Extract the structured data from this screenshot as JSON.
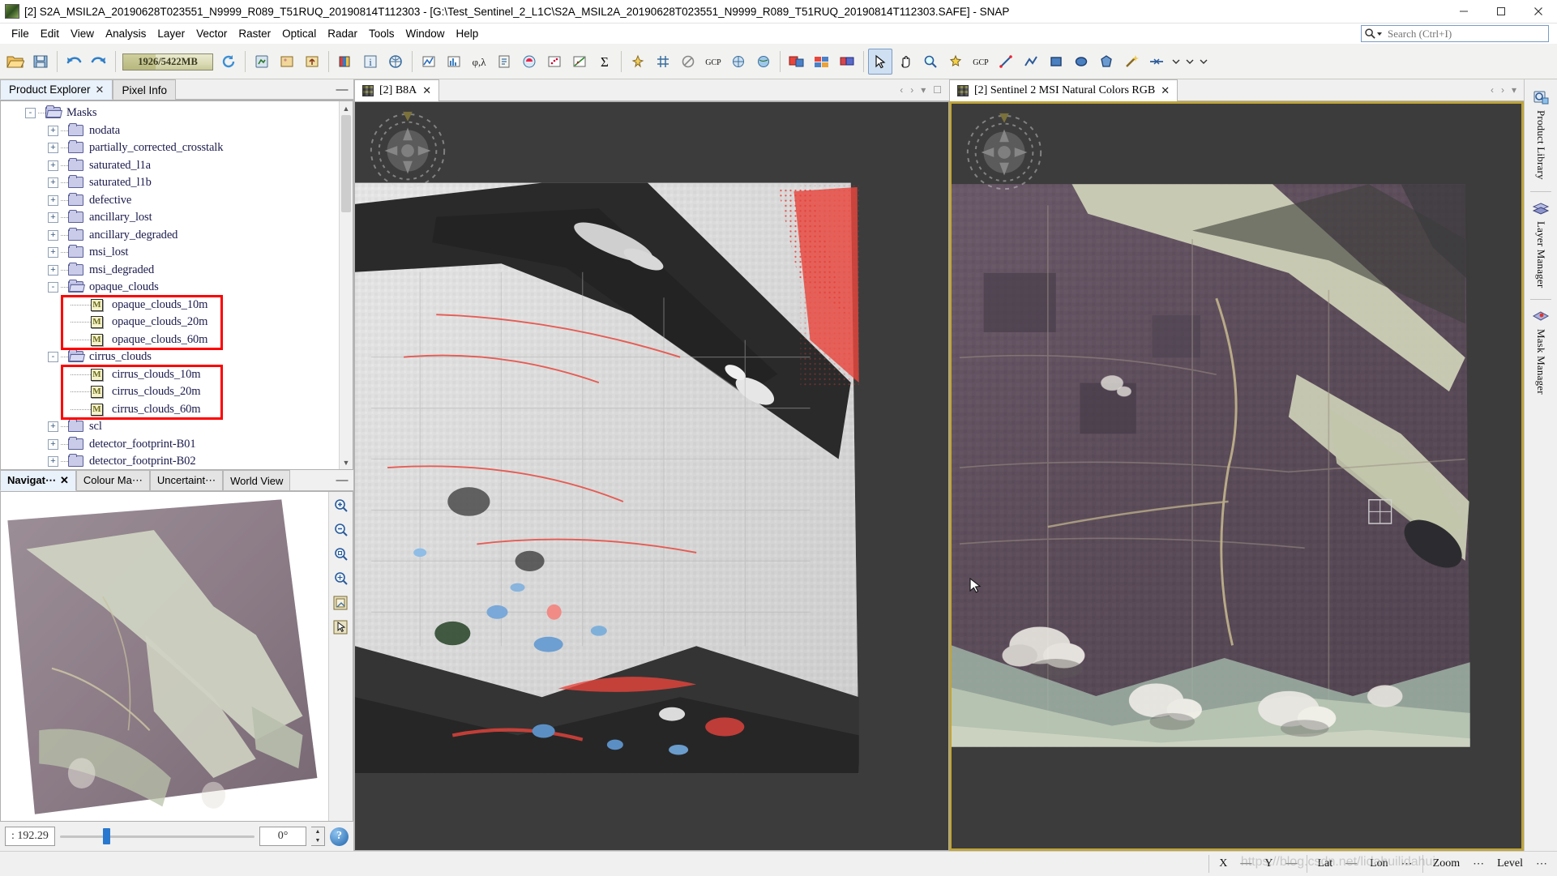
{
  "window": {
    "title": "[2] S2A_MSIL2A_20190628T023551_N9999_R089_T51RUQ_20190814T112303 - [G:\\Test_Sentinel_2_L1C\\S2A_MSIL2A_20190628T023551_N9999_R089_T51RUQ_20190814T112303.SAFE] - SNAP",
    "minimize": "–",
    "maximize": "☐",
    "close": "✕"
  },
  "menu": {
    "items": [
      "File",
      "Edit",
      "View",
      "Analysis",
      "Layer",
      "Vector",
      "Raster",
      "Optical",
      "Radar",
      "Tools",
      "Window",
      "Help"
    ]
  },
  "search": {
    "placeholder": "Search (Ctrl+I)",
    "value": ""
  },
  "toolbar": {
    "memory": "1926/5422MB",
    "memory_percent": 36,
    "buttons": [
      "open-product-icon",
      "save-product-icon",
      "undo-icon",
      "redo-icon",
      "memory-bar",
      "refresh-icon",
      "import-vector-icon",
      "import-raster-icon",
      "export-icon",
      "colour-manipulation-icon",
      "information-icon",
      "geo-coding-icon",
      "profile-plot-icon",
      "histogram-icon",
      "phi-lambda-icon",
      "statistics-panel-icon",
      "mask-manager-icon",
      "scatter-plot-icon",
      "correlative-plot-icon",
      "sum-icon",
      "pin-manager-icon",
      "gcp-manager-icon",
      "no-data-icon",
      "product-library-icon",
      "subset-icon",
      "mosaic-icon",
      "collocation-icon",
      "select-tool-icon",
      "pan-tool-icon",
      "zoom-tool-icon",
      "pin-placing-icon",
      "gcp-placing-icon",
      "line-drawing-icon",
      "polyline-drawing-icon",
      "rectangle-drawing-icon",
      "ellipse-drawing-icon",
      "polygon-drawing-icon",
      "magic-wand-icon",
      "range-finder-icon"
    ]
  },
  "left_dock": {
    "tabs": [
      {
        "label": "Product Explorer",
        "closable": true,
        "selected": true
      },
      {
        "label": "Pixel Info",
        "closable": false,
        "selected": false
      }
    ],
    "minimize_label": "—",
    "tree": [
      {
        "label": "Masks",
        "depth": 1,
        "type": "folder-open",
        "expander": "-",
        "highlight": false
      },
      {
        "label": "nodata",
        "depth": 2,
        "type": "folder",
        "expander": "+",
        "highlight": false
      },
      {
        "label": "partially_corrected_crosstalk",
        "depth": 2,
        "type": "folder",
        "expander": "+",
        "highlight": false
      },
      {
        "label": "saturated_l1a",
        "depth": 2,
        "type": "folder",
        "expander": "+",
        "highlight": false
      },
      {
        "label": "saturated_l1b",
        "depth": 2,
        "type": "folder",
        "expander": "+",
        "highlight": false
      },
      {
        "label": "defective",
        "depth": 2,
        "type": "folder",
        "expander": "+",
        "highlight": false
      },
      {
        "label": "ancillary_lost",
        "depth": 2,
        "type": "folder",
        "expander": "+",
        "highlight": false
      },
      {
        "label": "ancillary_degraded",
        "depth": 2,
        "type": "folder",
        "expander": "+",
        "highlight": false
      },
      {
        "label": "msi_lost",
        "depth": 2,
        "type": "folder",
        "expander": "+",
        "highlight": false
      },
      {
        "label": "msi_degraded",
        "depth": 2,
        "type": "folder",
        "expander": "+",
        "highlight": false
      },
      {
        "label": "opaque_clouds",
        "depth": 2,
        "type": "folder-open",
        "expander": "-",
        "highlight": false
      },
      {
        "label": "opaque_clouds_10m",
        "depth": 3,
        "type": "mask",
        "expander": "",
        "highlight": true
      },
      {
        "label": "opaque_clouds_20m",
        "depth": 3,
        "type": "mask",
        "expander": "",
        "highlight": true
      },
      {
        "label": "opaque_clouds_60m",
        "depth": 3,
        "type": "mask",
        "expander": "",
        "highlight": true
      },
      {
        "label": "cirrus_clouds",
        "depth": 2,
        "type": "folder-open",
        "expander": "-",
        "highlight": false
      },
      {
        "label": "cirrus_clouds_10m",
        "depth": 3,
        "type": "mask",
        "expander": "",
        "highlight": true
      },
      {
        "label": "cirrus_clouds_20m",
        "depth": 3,
        "type": "mask",
        "expander": "",
        "highlight": true
      },
      {
        "label": "cirrus_clouds_60m",
        "depth": 3,
        "type": "mask",
        "expander": "",
        "highlight": true
      },
      {
        "label": "scl",
        "depth": 2,
        "type": "folder",
        "expander": "+",
        "highlight": false
      },
      {
        "label": "detector_footprint-B01",
        "depth": 2,
        "type": "folder",
        "expander": "+",
        "highlight": false
      },
      {
        "label": "detector_footprint-B02",
        "depth": 2,
        "type": "folder",
        "expander": "+",
        "highlight": false
      }
    ],
    "highlight_color": "#ff0000"
  },
  "navigator": {
    "tabs": [
      {
        "label": "Navigat⋯",
        "closable": true,
        "selected": true
      },
      {
        "label": "Colour Ma⋯",
        "closable": false,
        "selected": false
      },
      {
        "label": "Uncertaint⋯",
        "closable": false,
        "selected": false
      },
      {
        "label": "World View",
        "closable": false,
        "selected": false
      }
    ],
    "minimize_label": "—",
    "zoom_value": ": 192.29",
    "rotation_value": "0°",
    "help_label": "?",
    "tools": [
      "zoom-in-icon",
      "zoom-out-icon",
      "zoom-to-pixel-icon",
      "zoom-all-icon",
      "sync-views-icon",
      "sync-cursor-icon"
    ]
  },
  "editors": [
    {
      "tab_label": "[2] B8A",
      "close_label": "✕",
      "selected": false,
      "nav_prev": "‹",
      "nav_next": "›",
      "nav_list": "▾",
      "nav_max": "☐"
    },
    {
      "tab_label": "[2] Sentinel 2 MSI Natural Colors RGB",
      "close_label": "✕",
      "selected": true,
      "nav_prev": "‹",
      "nav_next": "›",
      "nav_list": "▾",
      "nav_max": "☐"
    }
  ],
  "right_dock": {
    "tabs": [
      {
        "label": "Product Library",
        "icon": "product-library-icon"
      },
      {
        "label": "Layer Manager",
        "icon": "layers-icon"
      },
      {
        "label": "Mask Manager",
        "icon": "mask-icon"
      }
    ]
  },
  "status_bar": {
    "x_label": "X",
    "x_value": "—",
    "y_label": "Y",
    "y_value": "—",
    "lat_label": "Lat",
    "lat_value": "—",
    "lon_label": "Lon",
    "lon_value": "⋯",
    "zoom_label": "Zoom",
    "zoom_value": "⋯",
    "level_label": "Level",
    "level_value": "⋯",
    "watermark": "https://blog.csdn.net/lidahuilidahui"
  }
}
